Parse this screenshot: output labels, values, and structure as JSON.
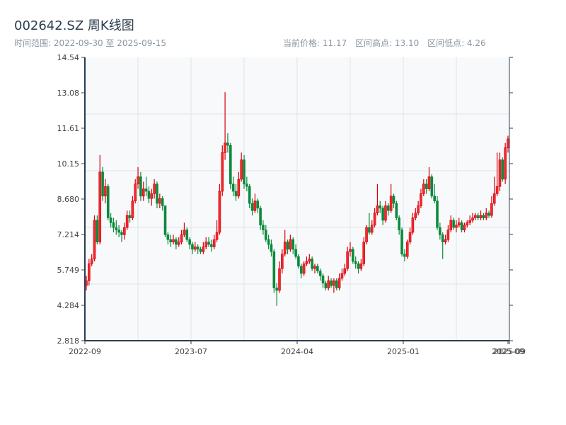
{
  "header": {
    "title": "002642.SZ 周K线图",
    "range_label": "时间范围: 2022-09-30 至 2025-09-15",
    "current_price": "当前价格: 11.17",
    "range_high": "区间高点: 13.10",
    "range_low": "区间低点: 4.26"
  },
  "chart_data": {
    "type": "candlestick",
    "title": "002642.SZ 周K线图",
    "start_date": "2022-09-30",
    "end_date": "2025-09-15",
    "ylim": [
      2.818,
      14.54
    ],
    "y_ticks": [
      "2.818",
      "4.284",
      "5.749",
      "7.214",
      "8.680",
      "10.15",
      "11.61",
      "13.08",
      "14.54"
    ],
    "x_ticks": [
      "2022-09",
      "2023-07",
      "2024-04",
      "2025-01",
      "2025-09",
      "2025-09"
    ],
    "grid": true,
    "colors": {
      "up": "#d7000f",
      "up_fill": "#f02a2a",
      "down": "#0b8a3b",
      "axis": "#2c3e50",
      "grid": "#e1e5ea",
      "plot_bg": "#f7f9fb"
    },
    "ohlc_columns": [
      "open",
      "high",
      "low",
      "close"
    ],
    "ohlc": [
      [
        5.1,
        5.5,
        4.9,
        5.3
      ],
      [
        5.3,
        6.2,
        5.1,
        6.0
      ],
      [
        6.0,
        6.4,
        5.9,
        6.2
      ],
      [
        6.2,
        8.0,
        6.1,
        7.8
      ],
      [
        7.8,
        8.0,
        6.8,
        6.9
      ],
      [
        6.9,
        10.5,
        6.8,
        9.8
      ],
      [
        9.8,
        10.0,
        8.6,
        8.8
      ],
      [
        8.8,
        9.5,
        8.5,
        9.2
      ],
      [
        9.2,
        9.3,
        7.8,
        7.9
      ],
      [
        7.9,
        8.1,
        7.5,
        7.7
      ],
      [
        7.7,
        7.9,
        7.3,
        7.5
      ],
      [
        7.5,
        7.8,
        7.2,
        7.4
      ],
      [
        7.4,
        7.6,
        7.1,
        7.3
      ],
      [
        7.3,
        7.4,
        6.9,
        7.2
      ],
      [
        7.2,
        7.7,
        7.0,
        7.5
      ],
      [
        7.5,
        8.2,
        7.4,
        8.0
      ],
      [
        8.0,
        8.2,
        7.7,
        7.9
      ],
      [
        7.9,
        8.8,
        7.8,
        8.6
      ],
      [
        8.6,
        9.5,
        8.5,
        9.3
      ],
      [
        9.3,
        10.0,
        9.1,
        9.6
      ],
      [
        9.6,
        9.8,
        8.6,
        8.8
      ],
      [
        8.8,
        9.4,
        8.6,
        9.1
      ],
      [
        9.1,
        9.6,
        8.8,
        9.0
      ],
      [
        9.0,
        9.2,
        8.5,
        8.7
      ],
      [
        8.7,
        9.1,
        8.4,
        8.9
      ],
      [
        8.9,
        9.5,
        8.7,
        9.3
      ],
      [
        9.3,
        9.4,
        8.3,
        8.5
      ],
      [
        8.5,
        8.9,
        8.3,
        8.7
      ],
      [
        8.7,
        8.8,
        8.2,
        8.4
      ],
      [
        8.4,
        8.4,
        7.1,
        7.2
      ],
      [
        7.2,
        7.3,
        6.8,
        7.0
      ],
      [
        7.0,
        7.2,
        6.7,
        6.9
      ],
      [
        6.9,
        7.2,
        6.8,
        7.0
      ],
      [
        7.0,
        7.1,
        6.6,
        6.8
      ],
      [
        6.8,
        7.1,
        6.7,
        6.9
      ],
      [
        6.9,
        7.4,
        6.8,
        7.2
      ],
      [
        7.2,
        7.7,
        7.1,
        7.4
      ],
      [
        7.4,
        7.5,
        6.9,
        7.0
      ],
      [
        7.0,
        7.1,
        6.6,
        6.8
      ],
      [
        6.8,
        6.9,
        6.4,
        6.6
      ],
      [
        6.6,
        6.9,
        6.5,
        6.7
      ],
      [
        6.7,
        6.8,
        6.4,
        6.6
      ],
      [
        6.6,
        6.7,
        6.4,
        6.5
      ],
      [
        6.5,
        6.9,
        6.4,
        6.7
      ],
      [
        6.7,
        7.1,
        6.6,
        6.9
      ],
      [
        6.9,
        7.1,
        6.7,
        6.8
      ],
      [
        6.8,
        7.0,
        6.5,
        6.7
      ],
      [
        6.7,
        7.2,
        6.6,
        7.0
      ],
      [
        7.0,
        7.8,
        6.9,
        7.3
      ],
      [
        7.3,
        9.3,
        7.2,
        9.0
      ],
      [
        9.0,
        10.9,
        8.8,
        10.6
      ],
      [
        10.6,
        13.1,
        10.3,
        11.0
      ],
      [
        11.0,
        11.4,
        10.6,
        10.9
      ],
      [
        10.9,
        11.0,
        9.1,
        9.3
      ],
      [
        9.3,
        9.6,
        8.8,
        9.0
      ],
      [
        9.0,
        9.3,
        8.6,
        8.8
      ],
      [
        8.8,
        9.8,
        8.7,
        9.5
      ],
      [
        9.5,
        10.6,
        9.4,
        10.3
      ],
      [
        10.3,
        10.5,
        9.1,
        9.3
      ],
      [
        9.3,
        9.6,
        9.0,
        9.2
      ],
      [
        9.2,
        9.3,
        8.3,
        8.5
      ],
      [
        8.5,
        8.7,
        8.0,
        8.2
      ],
      [
        8.2,
        8.9,
        8.1,
        8.6
      ],
      [
        8.6,
        8.7,
        8.1,
        8.3
      ],
      [
        8.3,
        8.4,
        7.4,
        7.6
      ],
      [
        7.6,
        7.8,
        7.2,
        7.4
      ],
      [
        7.4,
        7.6,
        6.9,
        7.0
      ],
      [
        7.0,
        7.2,
        6.6,
        6.8
      ],
      [
        6.8,
        7.0,
        6.3,
        6.5
      ],
      [
        6.5,
        6.6,
        4.8,
        5.0
      ],
      [
        5.0,
        5.2,
        4.26,
        4.9
      ],
      [
        4.9,
        6.1,
        4.8,
        5.8
      ],
      [
        5.8,
        6.6,
        5.6,
        6.4
      ],
      [
        6.4,
        7.4,
        6.3,
        6.9
      ],
      [
        6.9,
        7.0,
        6.4,
        6.6
      ],
      [
        6.6,
        7.2,
        6.5,
        7.0
      ],
      [
        7.0,
        7.1,
        6.4,
        6.6
      ],
      [
        6.6,
        6.8,
        6.2,
        6.3
      ],
      [
        6.3,
        6.4,
        5.8,
        5.9
      ],
      [
        5.9,
        6.0,
        5.4,
        5.6
      ],
      [
        5.6,
        6.1,
        5.5,
        6.0
      ],
      [
        6.0,
        6.3,
        5.9,
        6.1
      ],
      [
        6.1,
        6.4,
        6.0,
        6.2
      ],
      [
        6.2,
        6.3,
        5.7,
        5.8
      ],
      [
        5.8,
        6.0,
        5.6,
        5.9
      ],
      [
        5.9,
        6.0,
        5.6,
        5.7
      ],
      [
        5.7,
        5.8,
        5.3,
        5.5
      ],
      [
        5.5,
        5.6,
        5.0,
        5.2
      ],
      [
        5.2,
        5.3,
        4.9,
        5.0
      ],
      [
        5.0,
        5.5,
        4.9,
        5.3
      ],
      [
        5.3,
        5.4,
        5.0,
        5.1
      ],
      [
        5.1,
        5.4,
        4.8,
        5.3
      ],
      [
        5.3,
        5.4,
        4.9,
        5.0
      ],
      [
        5.0,
        5.6,
        4.9,
        5.4
      ],
      [
        5.4,
        5.8,
        5.3,
        5.6
      ],
      [
        5.6,
        6.0,
        5.5,
        5.8
      ],
      [
        5.8,
        6.7,
        5.7,
        6.5
      ],
      [
        6.5,
        6.9,
        6.3,
        6.6
      ],
      [
        6.6,
        6.7,
        6.0,
        6.1
      ],
      [
        6.1,
        6.3,
        5.8,
        6.0
      ],
      [
        6.0,
        6.1,
        5.6,
        5.8
      ],
      [
        5.8,
        6.2,
        5.7,
        6.0
      ],
      [
        6.0,
        7.1,
        5.9,
        6.9
      ],
      [
        6.9,
        7.6,
        6.8,
        7.5
      ],
      [
        7.5,
        8.1,
        7.2,
        7.3
      ],
      [
        7.3,
        7.8,
        7.2,
        7.6
      ],
      [
        7.6,
        8.3,
        7.5,
        8.1
      ],
      [
        8.1,
        9.3,
        8.0,
        8.4
      ],
      [
        8.4,
        8.6,
        8.1,
        8.3
      ],
      [
        8.3,
        8.4,
        7.6,
        7.8
      ],
      [
        7.8,
        8.6,
        7.7,
        8.4
      ],
      [
        8.4,
        8.5,
        8.0,
        8.2
      ],
      [
        8.2,
        9.3,
        8.1,
        8.8
      ],
      [
        8.8,
        8.9,
        8.3,
        8.5
      ],
      [
        8.5,
        8.6,
        7.8,
        7.9
      ],
      [
        7.9,
        8.0,
        7.2,
        7.4
      ],
      [
        7.4,
        7.5,
        6.3,
        6.4
      ],
      [
        6.4,
        6.6,
        6.1,
        6.3
      ],
      [
        6.3,
        7.0,
        6.2,
        6.9
      ],
      [
        6.9,
        7.5,
        6.8,
        7.3
      ],
      [
        7.3,
        8.1,
        7.2,
        7.9
      ],
      [
        7.9,
        8.3,
        7.8,
        8.1
      ],
      [
        8.1,
        8.6,
        8.0,
        8.4
      ],
      [
        8.4,
        9.1,
        8.3,
        8.9
      ],
      [
        8.9,
        9.5,
        8.8,
        9.3
      ],
      [
        9.3,
        9.5,
        8.9,
        9.1
      ],
      [
        9.1,
        10.0,
        9.0,
        9.6
      ],
      [
        9.6,
        9.7,
        8.7,
        8.8
      ],
      [
        8.8,
        9.3,
        8.5,
        8.6
      ],
      [
        8.6,
        8.8,
        7.4,
        7.5
      ],
      [
        7.5,
        7.7,
        7.0,
        7.2
      ],
      [
        7.2,
        7.3,
        6.2,
        6.9
      ],
      [
        6.9,
        7.2,
        6.8,
        7.0
      ],
      [
        7.0,
        7.6,
        6.9,
        7.4
      ],
      [
        7.4,
        8.0,
        7.3,
        7.8
      ],
      [
        7.8,
        7.9,
        7.4,
        7.5
      ],
      [
        7.5,
        7.8,
        7.3,
        7.6
      ],
      [
        7.6,
        7.9,
        7.5,
        7.7
      ],
      [
        7.7,
        7.8,
        7.3,
        7.4
      ],
      [
        7.4,
        7.7,
        7.3,
        7.6
      ],
      [
        7.6,
        7.8,
        7.5,
        7.7
      ],
      [
        7.7,
        8.0,
        7.6,
        7.8
      ],
      [
        7.8,
        8.1,
        7.7,
        7.9
      ],
      [
        7.9,
        8.1,
        7.8,
        8.0
      ],
      [
        8.0,
        8.1,
        7.8,
        7.9
      ],
      [
        7.9,
        8.2,
        7.8,
        8.0
      ],
      [
        8.0,
        8.1,
        7.8,
        7.9
      ],
      [
        7.9,
        8.3,
        7.8,
        8.1
      ],
      [
        8.1,
        8.2,
        7.9,
        8.0
      ],
      [
        8.0,
        8.8,
        7.9,
        8.5
      ],
      [
        8.5,
        9.6,
        8.4,
        8.9
      ],
      [
        8.9,
        10.6,
        8.8,
        9.2
      ],
      [
        9.2,
        10.6,
        9.0,
        10.3
      ],
      [
        10.3,
        10.4,
        9.4,
        9.5
      ],
      [
        9.5,
        11.0,
        9.3,
        10.8
      ],
      [
        10.8,
        11.3,
        10.6,
        11.17
      ]
    ]
  }
}
